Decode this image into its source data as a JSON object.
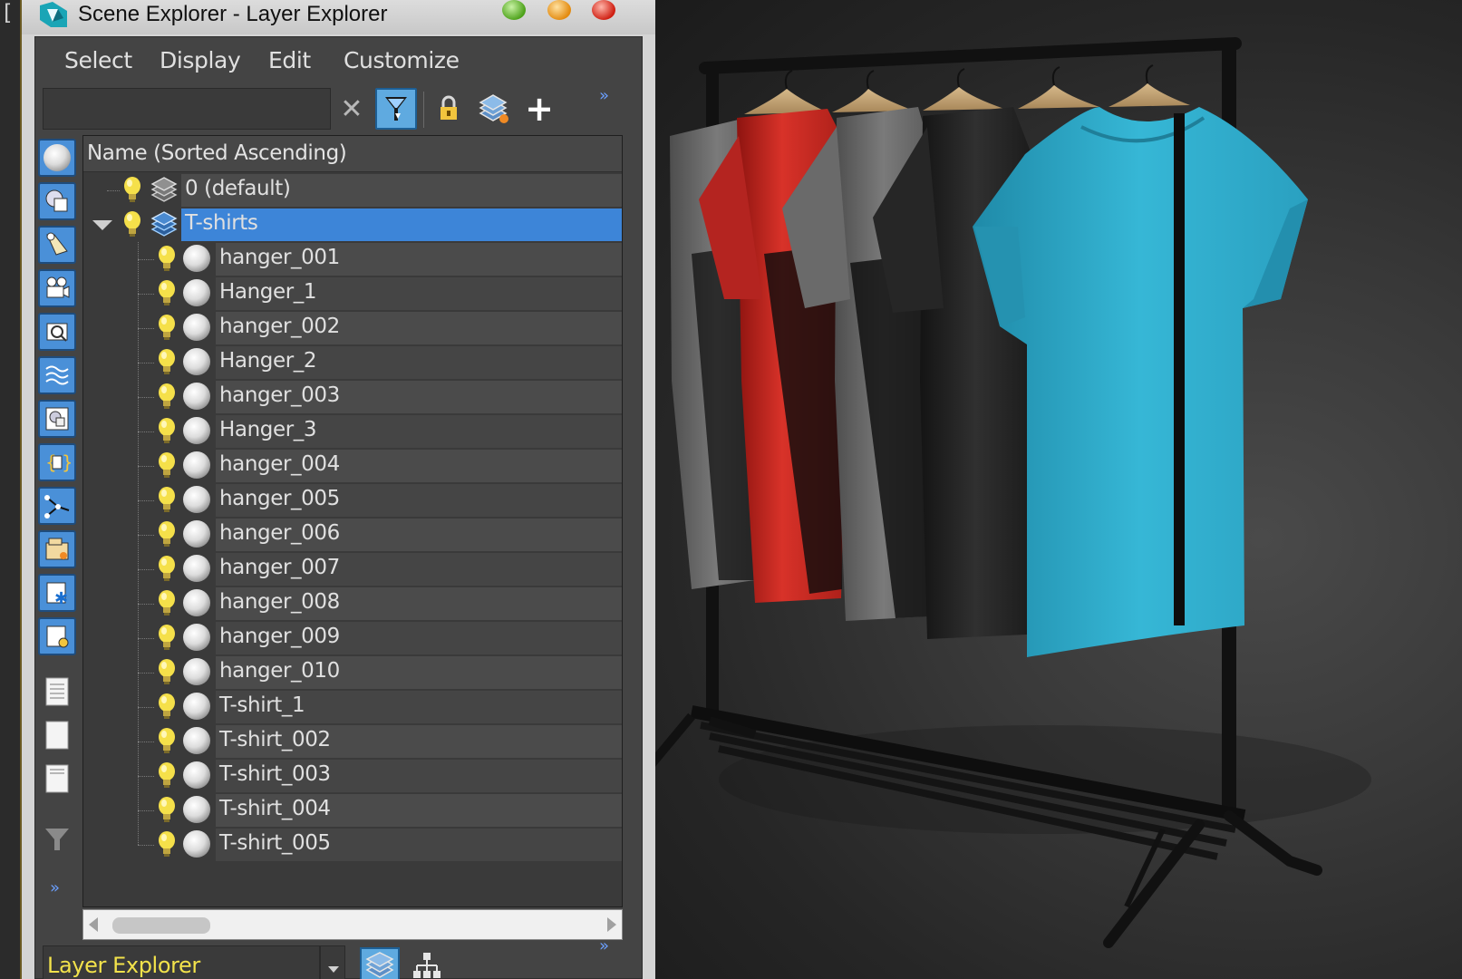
{
  "window": {
    "title": "Scene Explorer - Layer Explorer",
    "left_strip_glyph": "["
  },
  "menu": {
    "items": [
      "Select",
      "Display",
      "Edit",
      "Customize"
    ]
  },
  "toolbar": {
    "search_value": "",
    "clear_glyph": "✕",
    "add_glyph": "+",
    "expand_glyph": "»"
  },
  "tree": {
    "header": "Name (Sorted Ascending)",
    "layers": [
      {
        "name": "0 (default)",
        "expanded": false,
        "selected": false
      },
      {
        "name": "T-shirts",
        "expanded": true,
        "selected": true
      }
    ],
    "objects": [
      "hanger_001",
      "Hanger_1",
      "hanger_002",
      "Hanger_2",
      "hanger_003",
      "Hanger_3",
      "hanger_004",
      "hanger_005",
      "hanger_006",
      "hanger_007",
      "hanger_008",
      "hanger_009",
      "hanger_010",
      "T-shirt_1",
      "T-shirt_002",
      "T-shirt_003",
      "T-shirt_004",
      "T-shirt_005"
    ]
  },
  "bottom": {
    "explorer_name": "Layer Explorer",
    "expand_glyph": "»"
  },
  "colors": {
    "selection": "#3d85d8",
    "explorer_label": "#f2e24b",
    "shirt_cyan": "#2fa9c8",
    "shirt_red": "#c42a25",
    "shirt_grey": "#6e6e6e",
    "shirt_black": "#242424",
    "hanger_wood": "#c8a878"
  }
}
